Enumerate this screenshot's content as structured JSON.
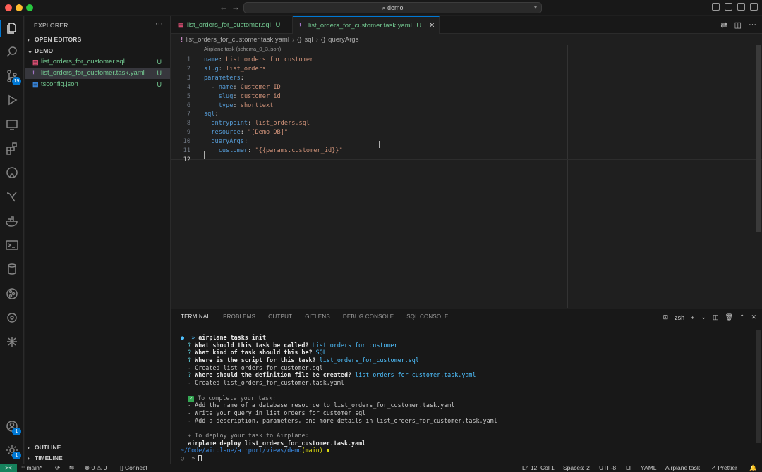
{
  "window": {
    "command_center": "demo",
    "nav_back": "←",
    "nav_forward": "→"
  },
  "activity_bar": {
    "scm_badge": "19",
    "accounts_badge": "1",
    "settings_badge": "1"
  },
  "sidebar": {
    "title": "EXPLORER",
    "more": "···",
    "open_editors": "OPEN EDITORS",
    "folder": "DEMO",
    "files": [
      {
        "icon": "▤",
        "icon_color": "#e8527a",
        "name": "list_orders_for_customer.sql",
        "status": "U"
      },
      {
        "icon": "!",
        "icon_color": "#a074c4",
        "name": "list_orders_for_customer.task.yaml",
        "status": "U"
      },
      {
        "icon": "▤",
        "icon_color": "#3b8eea",
        "name": "tsconfig.json",
        "status": "U"
      }
    ],
    "outline": "OUTLINE",
    "timeline": "TIMELINE"
  },
  "tabs": [
    {
      "icon": "▤",
      "icon_color": "#e8527a",
      "label": "list_orders_for_customer.sql",
      "status": "U"
    },
    {
      "icon": "!",
      "icon_color": "#a074c4",
      "label": "list_orders_for_customer.task.yaml",
      "status": "U",
      "close": "✕"
    }
  ],
  "breadcrumb": {
    "icon": "!",
    "file": "list_orders_for_customer.task.yaml",
    "sep1": "›",
    "item1_icon": "{}",
    "item1": "sql",
    "sep2": "›",
    "item2_icon": "{}",
    "item2": "queryArgs"
  },
  "editor": {
    "codelens": "Airplane task (schema_0_3.json)",
    "lines": [
      {
        "n": "1",
        "indent": "",
        "key": "name",
        "sep": ": ",
        "val": "List orders for customer"
      },
      {
        "n": "2",
        "indent": "",
        "key": "slug",
        "sep": ": ",
        "val": "list_orders"
      },
      {
        "n": "3",
        "indent": "",
        "key": "parameters",
        "sep": ":",
        "val": ""
      },
      {
        "n": "4",
        "indent": "  - ",
        "key": "name",
        "sep": ": ",
        "val": "Customer ID"
      },
      {
        "n": "5",
        "indent": "    ",
        "key": "slug",
        "sep": ": ",
        "val": "customer_id"
      },
      {
        "n": "6",
        "indent": "    ",
        "key": "type",
        "sep": ": ",
        "val": "shorttext"
      },
      {
        "n": "7",
        "indent": "",
        "key": "sql",
        "sep": ":",
        "val": ""
      },
      {
        "n": "8",
        "indent": "  ",
        "key": "entrypoint",
        "sep": ": ",
        "val": "list_orders.sql"
      },
      {
        "n": "9",
        "indent": "  ",
        "key": "resource",
        "sep": ": ",
        "val": "\"[Demo DB]\""
      },
      {
        "n": "10",
        "indent": "  ",
        "key": "queryArgs",
        "sep": ":",
        "val": ""
      },
      {
        "n": "11",
        "indent": "    ",
        "key": "customer",
        "sep": ": ",
        "val": "\"{{params.customer_id}}\""
      },
      {
        "n": "12",
        "indent": "",
        "key": "",
        "sep": "",
        "val": ""
      }
    ]
  },
  "panel": {
    "tabs": [
      "TERMINAL",
      "PROBLEMS",
      "OUTPUT",
      "GITLENS",
      "DEBUG CONSOLE",
      "SQL CONSOLE"
    ],
    "shell": "zsh",
    "terminal": {
      "cmd_prompt": "●  »",
      "cmd": " airplane tasks init",
      "q1": "What should this task be called?",
      "a1": "List orders for customer",
      "q2": "What kind of task should this be?",
      "a2": "SQL",
      "q3": "Where is the script for this task?",
      "a3": "list_orders_for_customer.sql",
      "created1": "- Created list_orders_for_customer.sql",
      "q4": "Where should the definition file be created?",
      "a4": "list_orders_for_customer.task.yaml",
      "created2": "- Created list_orders_for_customer.task.yaml",
      "complete": " To complete your task:",
      "step1": "- Add the name of a database resource to list_orders_for_customer.task.yaml",
      "step2": "- Write your query in list_orders_for_customer.sql",
      "step3": "- Add a description, parameters, and more details in list_orders_for_customer.task.yaml",
      "deploy_hint": " To deploy your task to Airplane:",
      "deploy_cmd": "  airplane deploy list_orders_for_customer.task.yaml",
      "path": "~/Code/airplane/airport/views/demo",
      "branch": "(main)",
      "branch_mark": " ✘",
      "prompt": "○  »"
    }
  },
  "statusbar": {
    "branch": "main*",
    "errors": "0",
    "warnings": "0",
    "connect": "Connect",
    "position": "Ln 12, Col 1",
    "spaces": "Spaces: 2",
    "encoding": "UTF-8",
    "eol": "LF",
    "language": "YAML",
    "schema": "Airplane task",
    "prettier": "✓ Prettier"
  }
}
